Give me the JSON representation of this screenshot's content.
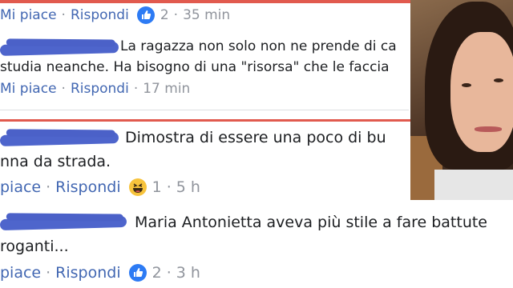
{
  "comments": [
    {
      "text": "",
      "actions": {
        "like": "Mi piace",
        "reply": "Rispondi",
        "reactions": "2",
        "time": "35 min",
        "reaction_icon": "like-icon"
      }
    },
    {
      "lines": [
        "La ragazza non solo non ne prende di ca",
        "studia neanche. Ha bisogno di una \"risorsa\" che le faccia"
      ],
      "actions": {
        "like": "Mi piace",
        "reply": "Rispondi",
        "time": "17 min"
      }
    },
    {
      "lines": [
        "Dimostra di essere una poco di bu",
        "nna da strada."
      ],
      "actions": {
        "like": "piace",
        "reply": "Rispondi",
        "reactions": "1",
        "time": "5 h",
        "reaction_icon": "haha-icon"
      }
    },
    {
      "lines": [
        "Maria Antonietta aveva più stile a fare battute",
        "roganti..."
      ],
      "actions": {
        "like": "piace",
        "reply": "Rispondi",
        "reactions": "2",
        "time": "3 h",
        "reaction_icon": "like-icon"
      }
    }
  ],
  "separator": "·",
  "colors": {
    "link": "#4267b2",
    "meta": "#90949c",
    "accent_bar": "#e15a4e",
    "like_blue": "#2d7bf4",
    "scribble": "#3f58c8"
  }
}
